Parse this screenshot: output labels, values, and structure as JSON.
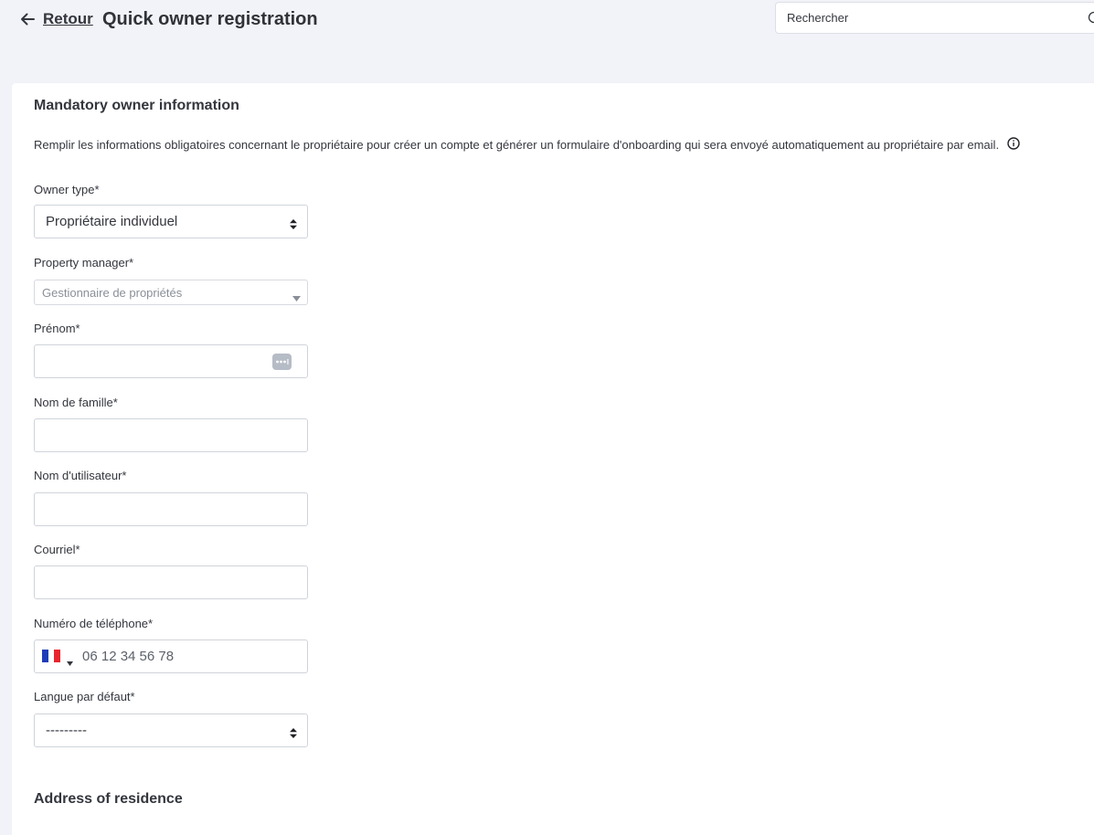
{
  "header": {
    "back_label": "Retour",
    "title": "Quick owner registration",
    "search_placeholder": "Rechercher"
  },
  "mandatory": {
    "title": "Mandatory owner information",
    "intro": "Remplir les informations obligatoires concernant le propriétaire pour créer un compte et générer un formulaire d'onboarding qui sera envoyé automatiquement au propriétaire par email."
  },
  "fields": {
    "owner_type": {
      "label": "Owner type*",
      "value": "Propriétaire individuel"
    },
    "property_manager": {
      "label": "Property manager*",
      "placeholder": "Gestionnaire de propriétés"
    },
    "first_name": {
      "label": "Prénom*",
      "value": ""
    },
    "last_name": {
      "label": "Nom de famille*",
      "value": ""
    },
    "username": {
      "label": "Nom d'utilisateur*",
      "value": ""
    },
    "email": {
      "label": "Courriel*",
      "value": ""
    },
    "phone": {
      "label": "Numéro de téléphone*",
      "placeholder": "06 12 34 56 78",
      "country_flag": "france-flag-icon"
    },
    "language": {
      "label": "Langue par défaut*",
      "value": "---------"
    }
  },
  "address": {
    "title": "Address of residence"
  },
  "colors": {
    "page_bg": "#f1f3f8",
    "card_bg": "#ffffff",
    "text": "#33363d",
    "border": "#cfd3da",
    "flag_blue": "#1e3db8",
    "flag_white": "#ffffff",
    "flag_red": "#e8252f"
  }
}
